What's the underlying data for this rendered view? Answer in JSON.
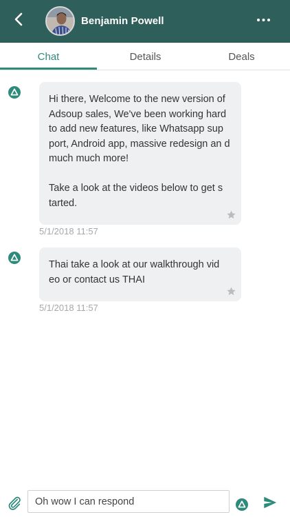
{
  "header": {
    "contact_name": "Benjamin Powell",
    "background_color": "#2f5f5b"
  },
  "tabs": [
    {
      "label": "Chat",
      "active": true
    },
    {
      "label": "Details",
      "active": false
    },
    {
      "label": "Deals",
      "active": false
    }
  ],
  "accent_color": "#2e8a7b",
  "messages": [
    {
      "text": "Hi there, Welcome to the new version of Adsoup sales, We've been working hard to add new features, like Whatsapp sup port, Android app, massive redesign an d much much more!\n\nTake a look at the videos below to get s tarted.",
      "timestamp": "5/1/2018 11:57",
      "sender_icon": "adsoup-logo-icon",
      "starred": false
    },
    {
      "text": "Thai take a look at our walkthrough vid eo or contact us THAI",
      "timestamp": "5/1/2018 11:57",
      "sender_icon": "adsoup-logo-icon",
      "starred": false
    }
  ],
  "composer": {
    "value": "Oh wow I can respond",
    "attach_icon": "paperclip-icon",
    "send_icon": "send-icon"
  }
}
